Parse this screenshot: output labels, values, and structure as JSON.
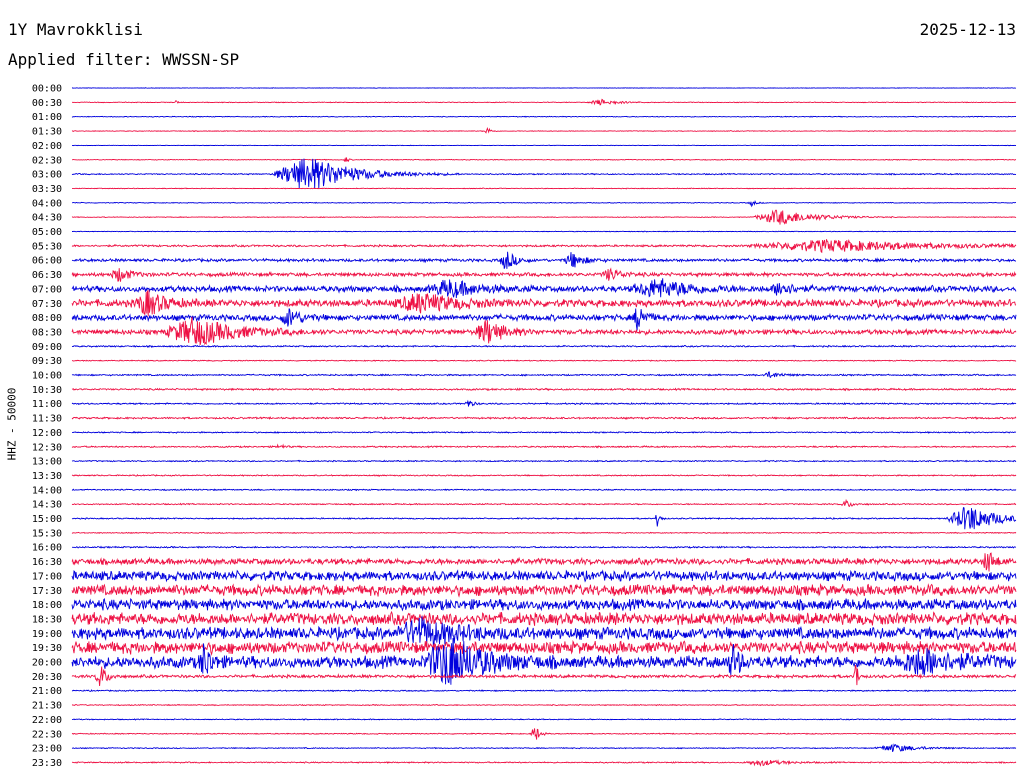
{
  "header": {
    "title": "1Y Mavrokklisi",
    "date": "2025-12-13",
    "filter": "Applied filter: WWSSN-SP"
  },
  "chart_data": {
    "type": "line",
    "subtype": "helicorder",
    "ylabel": "HHZ - 50000",
    "row_labels": [
      "00:00",
      "00:30",
      "01:00",
      "01:30",
      "02:00",
      "02:30",
      "03:00",
      "03:30",
      "04:00",
      "04:30",
      "05:00",
      "05:30",
      "06:00",
      "06:30",
      "07:00",
      "07:30",
      "08:00",
      "08:30",
      "09:00",
      "09:30",
      "10:00",
      "10:30",
      "11:00",
      "11:30",
      "12:00",
      "12:30",
      "13:00",
      "13:30",
      "14:00",
      "14:30",
      "15:00",
      "15:30",
      "16:00",
      "16:30",
      "17:00",
      "17:30",
      "18:00",
      "18:30",
      "19:00",
      "19:30",
      "20:00",
      "20:30",
      "21:00",
      "21:30",
      "22:00",
      "22:30",
      "23:00",
      "23:30"
    ],
    "colors": [
      "#0000dd",
      "#ee1144"
    ],
    "noise": [
      0.2,
      0.3,
      0.3,
      0.3,
      0.2,
      0.3,
      0.5,
      0.3,
      0.3,
      0.3,
      0.3,
      0.8,
      1.2,
      1.5,
      2.5,
      3.0,
      2.5,
      2.0,
      0.6,
      0.4,
      0.6,
      0.7,
      0.6,
      0.7,
      0.5,
      0.6,
      0.5,
      0.5,
      0.5,
      0.5,
      0.5,
      0.4,
      0.6,
      2.5,
      4.0,
      4.5,
      4.5,
      5.0,
      5.0,
      5.0,
      5.0,
      1.2,
      0.5,
      0.4,
      0.4,
      0.4,
      0.4,
      0.5
    ],
    "events": [
      {
        "row": 1,
        "x": 0.56,
        "amp": 3,
        "width": 0.015
      },
      {
        "row": 1,
        "x": 0.11,
        "amp": 2,
        "width": 0.002
      },
      {
        "row": 3,
        "x": 0.44,
        "amp": 4,
        "width": 0.003
      },
      {
        "row": 6,
        "x": 0.25,
        "amp": 18,
        "width": 0.04
      },
      {
        "row": 5,
        "x": 0.29,
        "amp": 4,
        "width": 0.002
      },
      {
        "row": 8,
        "x": 0.72,
        "amp": 3,
        "width": 0.004
      },
      {
        "row": 9,
        "x": 0.75,
        "amp": 8,
        "width": 0.03
      },
      {
        "row": 11,
        "x": 0.8,
        "amp": 6,
        "width": 0.09
      },
      {
        "row": 12,
        "x": 0.46,
        "amp": 10,
        "width": 0.008
      },
      {
        "row": 12,
        "x": 0.53,
        "amp": 8,
        "width": 0.01
      },
      {
        "row": 13,
        "x": 0.05,
        "amp": 7,
        "width": 0.01
      },
      {
        "row": 13,
        "x": 0.57,
        "amp": 6,
        "width": 0.01
      },
      {
        "row": 14,
        "x": 0.4,
        "amp": 8,
        "width": 0.025
      },
      {
        "row": 14,
        "x": 0.62,
        "amp": 9,
        "width": 0.03
      },
      {
        "row": 14,
        "x": 0.75,
        "amp": 8,
        "width": 0.01
      },
      {
        "row": 15,
        "x": 0.08,
        "amp": 12,
        "width": 0.015
      },
      {
        "row": 15,
        "x": 0.37,
        "amp": 9,
        "width": 0.03
      },
      {
        "row": 16,
        "x": 0.23,
        "amp": 9,
        "width": 0.01
      },
      {
        "row": 16,
        "x": 0.6,
        "amp": 14,
        "width": 0.006
      },
      {
        "row": 17,
        "x": 0.13,
        "amp": 14,
        "width": 0.035
      },
      {
        "row": 17,
        "x": 0.44,
        "amp": 12,
        "width": 0.015
      },
      {
        "row": 20,
        "x": 0.74,
        "amp": 3,
        "width": 0.01
      },
      {
        "row": 22,
        "x": 0.42,
        "amp": 4,
        "width": 0.004
      },
      {
        "row": 25,
        "x": 0.22,
        "amp": 3,
        "width": 0.004
      },
      {
        "row": 29,
        "x": 0.82,
        "amp": 4,
        "width": 0.006
      },
      {
        "row": 30,
        "x": 0.62,
        "amp": 12,
        "width": 0.002
      },
      {
        "row": 30,
        "x": 0.95,
        "amp": 14,
        "width": 0.025
      },
      {
        "row": 33,
        "x": 0.97,
        "amp": 12,
        "width": 0.006
      },
      {
        "row": 38,
        "x": 0.37,
        "amp": 12,
        "width": 0.03
      },
      {
        "row": 40,
        "x": 0.4,
        "amp": 24,
        "width": 0.03
      },
      {
        "row": 40,
        "x": 0.14,
        "amp": 18,
        "width": 0.006
      },
      {
        "row": 40,
        "x": 0.7,
        "amp": 16,
        "width": 0.006
      },
      {
        "row": 40,
        "x": 0.9,
        "amp": 12,
        "width": 0.03
      },
      {
        "row": 41,
        "x": 0.03,
        "amp": 12,
        "width": 0.006
      },
      {
        "row": 41,
        "x": 0.83,
        "amp": 20,
        "width": 0.002
      },
      {
        "row": 45,
        "x": 0.49,
        "amp": 10,
        "width": 0.004
      },
      {
        "row": 46,
        "x": 0.87,
        "amp": 4,
        "width": 0.02
      },
      {
        "row": 47,
        "x": 0.73,
        "amp": 3,
        "width": 0.02
      }
    ]
  }
}
